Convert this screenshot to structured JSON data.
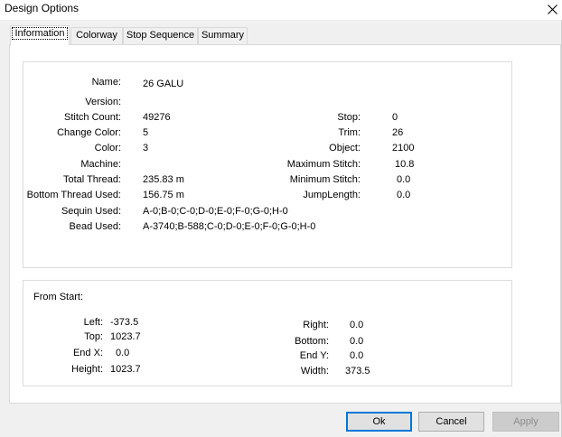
{
  "window": {
    "title": "Design Options",
    "close_icon": "close-icon"
  },
  "tabs": [
    {
      "label": "Information",
      "active": true
    },
    {
      "label": "Colorway",
      "active": false
    },
    {
      "label": "Stop Sequence",
      "active": false
    },
    {
      "label": "Summary",
      "active": false
    }
  ],
  "info": {
    "name_label": "Name:",
    "name_value": "26 GALU",
    "version_label": "Version:",
    "version_value": "",
    "stitch_count_label": "Stitch Count:",
    "stitch_count_value": "49276",
    "change_color_label": "Change Color:",
    "change_color_value": "5",
    "color_label": "Color:",
    "color_value": "3",
    "machine_label": "Machine:",
    "machine_value": "",
    "total_thread_label": "Total Thread:",
    "total_thread_value": "235.83 m",
    "bottom_thread_label": "Bottom Thread Used:",
    "bottom_thread_value": "156.75 m",
    "sequin_label": "Sequin Used:",
    "sequin_value": "A-0;B-0;C-0;D-0;E-0;F-0;G-0;H-0",
    "bead_label": "Bead Used:",
    "bead_value": "A-3740;B-588;C-0;D-0;E-0;F-0;G-0;H-0",
    "stop_label": "Stop:",
    "stop_value": "0",
    "trim_label": "Trim:",
    "trim_value": "26",
    "object_label": "Object:",
    "object_value": "2100",
    "max_stitch_label": "Maximum Stitch:",
    "max_stitch_value": "10.8",
    "min_stitch_label": "Minimum Stitch:",
    "min_stitch_value": "0.0",
    "jump_length_label": "JumpLength:",
    "jump_length_value": "0.0"
  },
  "from_start": {
    "heading": "From Start:",
    "left_label": "Left:",
    "left_value": "-373.5",
    "top_label": "Top:",
    "top_value": "1023.7",
    "endx_label": "End X:",
    "endx_value": "0.0",
    "height_label": "Height:",
    "height_value": "1023.7",
    "right_label": "Right:",
    "right_value": "0.0",
    "bottom_label": "Bottom:",
    "bottom_value": "0.0",
    "endy_label": "End Y:",
    "endy_value": "0.0",
    "width_label": "Width:",
    "width_value": "373.5"
  },
  "buttons": {
    "ok": "Ok",
    "cancel": "Cancel",
    "apply": "Apply"
  }
}
